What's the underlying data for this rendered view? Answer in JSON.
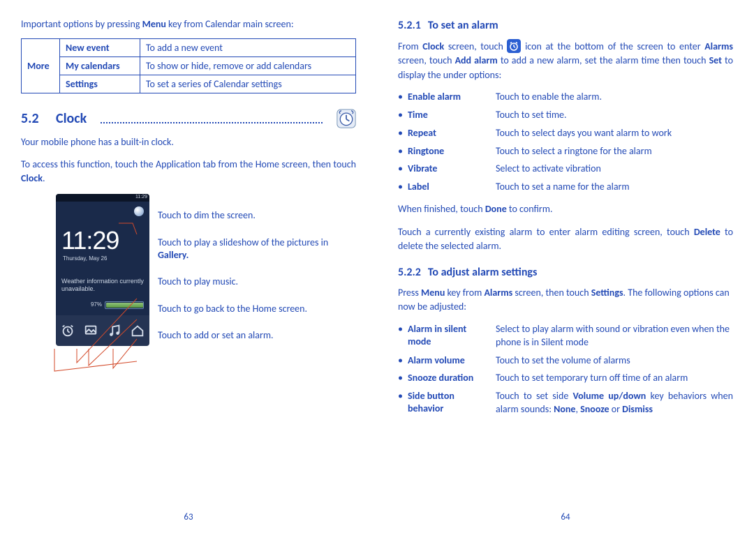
{
  "left": {
    "intro_pre": "Important options by pressing ",
    "intro_bold": "Menu",
    "intro_post": " key from Calendar main screen:",
    "table": {
      "more": "More",
      "rows": [
        {
          "label": "New event",
          "desc": "To add a new event"
        },
        {
          "label": "My calendars",
          "desc": "To show or hide, remove or add calendars"
        },
        {
          "label": "Settings",
          "desc": "To set a series of Calendar settings"
        }
      ]
    },
    "section_num": "5.2",
    "section_title": "Clock",
    "p1": "Your mobile phone has a built-in clock.",
    "p2_pre": "To access this function, touch the Application tab from the Home screen, then touch ",
    "p2_bold": "Clock",
    "p2_post": ".",
    "phone": {
      "status": "11:29",
      "time": "11:29",
      "date": "Thursday, May 26",
      "weather": "Weather information currently unavailable.",
      "battery": "97%"
    },
    "callouts": [
      "Touch to dim the screen.",
      {
        "pre": "Touch to play a slideshow of the pictures in ",
        "bold": "Gallery."
      },
      "Touch to play music.",
      "Touch to go back to the Home screen.",
      "Touch to add or set an alarm."
    ],
    "page_num": "63"
  },
  "right": {
    "h_521_num": "5.2.1",
    "h_521_title": "To set an alarm",
    "p521_parts": {
      "a": "From ",
      "b": "Clock",
      "c": " screen, touch ",
      "d": " icon at the bottom of the screen to enter ",
      "e": "Alarms",
      "f": " screen, touch ",
      "g": "Add alarm",
      "h": " to add a new alarm, set the alarm time then touch ",
      "i": "Set",
      "j": " to display the under options:"
    },
    "opts521": [
      {
        "label": "Enable alarm",
        "desc": "Touch to enable the alarm."
      },
      {
        "label": "Time",
        "desc": "Touch to set time."
      },
      {
        "label": "Repeat",
        "desc": "Touch to select days you want alarm to work"
      },
      {
        "label": "Ringtone",
        "desc": "Touch to select a ringtone for the alarm"
      },
      {
        "label": "Vibrate",
        "desc": "Select to activate vibration"
      },
      {
        "label": "Label",
        "desc": "Touch to set a name for the alarm"
      }
    ],
    "done_pre": "When finished, touch ",
    "done_bold": "Done",
    "done_post": " to confirm.",
    "edit_pre": "Touch a currently existing alarm to enter alarm editing screen, touch ",
    "edit_bold": "Delete",
    "edit_post": " to delete the selected alarm.",
    "h_522_num": "5.2.2",
    "h_522_title": "To adjust alarm settings",
    "p522_parts": {
      "a": "Press ",
      "b": "Menu",
      "c": " key from ",
      "d": "Alarms",
      "e": " screen, then touch ",
      "f": "Settings",
      "g": ". The following options can now be adjusted:"
    },
    "opts522": [
      {
        "label": "Alarm in silent mode",
        "desc": "Select to play alarm with sound or vibration even when the phone is in Silent mode"
      },
      {
        "label": "Alarm volume",
        "desc": "Touch to set the volume of alarms"
      },
      {
        "label": "Snooze duration",
        "desc": "Touch to set temporary turn off time of an alarm"
      }
    ],
    "opt522_side": {
      "label": "Side button behavior",
      "a": "Touch to set side ",
      "b": "Volume up/down",
      "c": " key behaviors when alarm sounds: ",
      "d": "None",
      "e": ", ",
      "f": "Snooze",
      "g": " or ",
      "h": "Dismiss"
    },
    "page_num": "64"
  }
}
